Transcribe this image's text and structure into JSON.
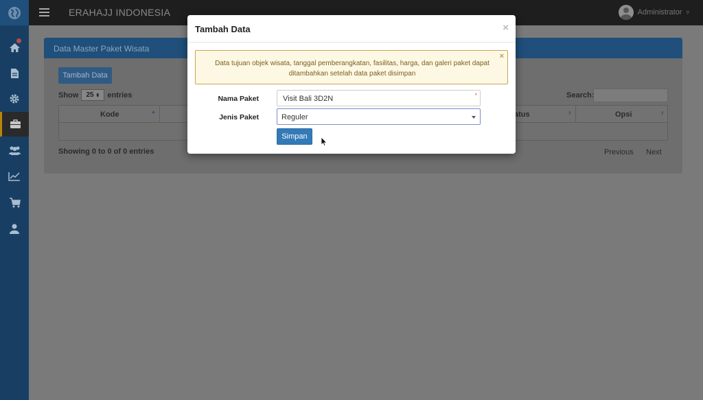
{
  "app": {
    "brand": "ERAHAJJ INDONESIA",
    "user_name": "Administrator",
    "user_caret": "▿"
  },
  "sidebar": {
    "items": [
      {
        "icon": "home-icon"
      },
      {
        "icon": "document-icon"
      },
      {
        "icon": "gear-icon"
      },
      {
        "icon": "briefcase-icon",
        "active": true
      },
      {
        "icon": "users-icon"
      },
      {
        "icon": "chart-line-icon"
      },
      {
        "icon": "cart-icon"
      },
      {
        "icon": "user-icon"
      }
    ]
  },
  "page": {
    "panel_title": "Data Master Paket Wisata",
    "add_button": "Tambah Data",
    "show_label": "Show",
    "entries_value": "25",
    "entries_label": "entries",
    "search_label": "Search:",
    "columns": {
      "kode": "Kode",
      "status_partial": "atus",
      "opsi": "Opsi"
    },
    "info": "Showing 0 to 0 of 0 entries",
    "previous": "Previous",
    "next": "Next"
  },
  "modal": {
    "title": "Tambah Data",
    "close": "×",
    "alert_text": "Data tujuan objek wisata, tanggal pemberangkatan, fasilitas, harga, dan galeri paket dapat ditambahkan setelah data paket disimpan",
    "alert_close": "×",
    "nama_label": "Nama Paket",
    "nama_value": "Visit Bali 3D2N",
    "required_mark": "*",
    "jenis_label": "Jenis Paket",
    "jenis_value": "Reguler",
    "save_button": "Simpan"
  },
  "colors": {
    "primary": "#337ab7",
    "sidebar": "#183f63",
    "alert_bg": "#fcf8e3",
    "topbar": "#1e1e1e"
  }
}
